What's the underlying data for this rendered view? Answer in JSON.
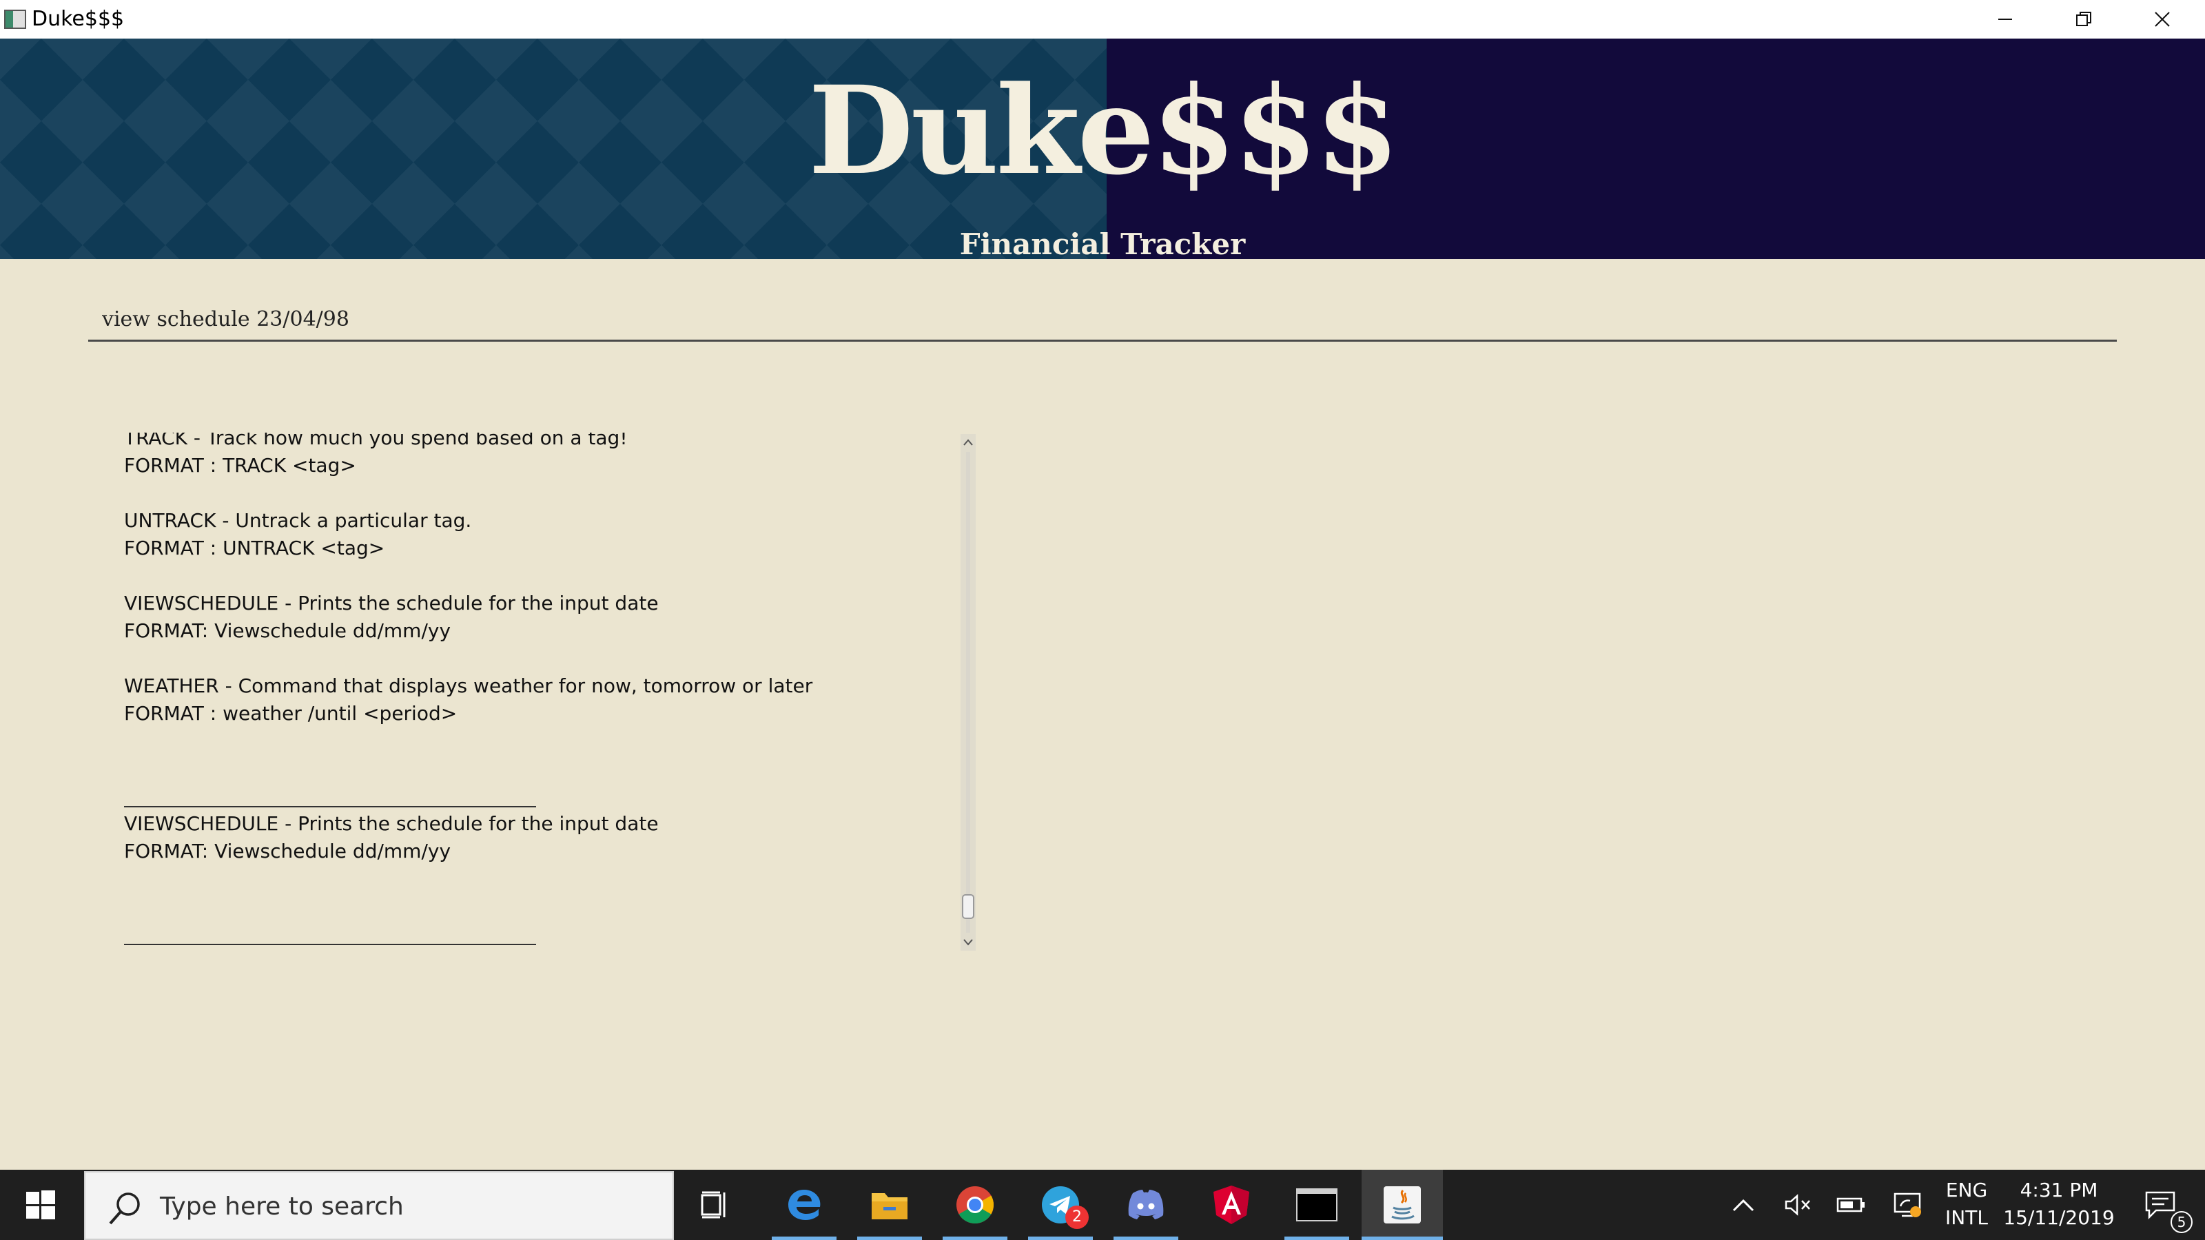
{
  "window": {
    "title": "Duke$$$",
    "controls": {
      "minimize": "minimize",
      "restore": "restore",
      "close": "close"
    }
  },
  "banner": {
    "brand": "Duke$$$",
    "subtitle": "Financial Tracker"
  },
  "command": {
    "value": "view schedule 23/04/98"
  },
  "output": {
    "lines": [
      {
        "type": "text",
        "text": "TRACK - Track how much you spend based on a tag!"
      },
      {
        "type": "text",
        "text": "FORMAT : TRACK <tag>"
      },
      {
        "type": "blank",
        "text": ""
      },
      {
        "type": "text",
        "text": "UNTRACK - Untrack a particular tag."
      },
      {
        "type": "text",
        "text": "FORMAT : UNTRACK <tag>"
      },
      {
        "type": "blank",
        "text": ""
      },
      {
        "type": "text",
        "text": "VIEWSCHEDULE - Prints the schedule for the input date"
      },
      {
        "type": "text",
        "text": "FORMAT: Viewschedule dd/mm/yy"
      },
      {
        "type": "blank",
        "text": ""
      },
      {
        "type": "text",
        "text": "WEATHER - Command that displays weather for now, tomorrow or later"
      },
      {
        "type": "text",
        "text": "FORMAT : weather /until <period>"
      },
      {
        "type": "blank",
        "text": ""
      },
      {
        "type": "blank",
        "text": ""
      },
      {
        "type": "separator",
        "text": ""
      },
      {
        "type": "text",
        "text": "VIEWSCHEDULE - Prints the schedule for the input date"
      },
      {
        "type": "text",
        "text": "FORMAT: Viewschedule dd/mm/yy"
      },
      {
        "type": "blank",
        "text": ""
      },
      {
        "type": "blank",
        "text": ""
      },
      {
        "type": "separator",
        "text": ""
      }
    ],
    "scroll_position": 0.97
  },
  "taskbar": {
    "search_placeholder": "Type here to search",
    "apps": [
      {
        "name": "task-view",
        "icon": "task-view-icon"
      },
      {
        "name": "edge",
        "icon": "edge-icon"
      },
      {
        "name": "file-explorer",
        "icon": "folder-icon"
      },
      {
        "name": "chrome",
        "icon": "chrome-icon"
      },
      {
        "name": "telegram",
        "icon": "telegram-icon",
        "badge": "2"
      },
      {
        "name": "discord",
        "icon": "discord-icon"
      },
      {
        "name": "angular",
        "icon": "angular-icon"
      },
      {
        "name": "terminal",
        "icon": "terminal-icon"
      },
      {
        "name": "java",
        "icon": "java-icon"
      }
    ],
    "tray": {
      "language_top": "ENG",
      "language_bottom": "INTL",
      "time": "4:31 PM",
      "date": "15/11/2019",
      "notification_count": "5"
    }
  },
  "colors": {
    "background": "#ebe5d0",
    "banner_left": "#0f3a55",
    "banner_right": "#120a3b",
    "banner_text": "#f4efdf",
    "taskbar": "#1f1f1f"
  }
}
